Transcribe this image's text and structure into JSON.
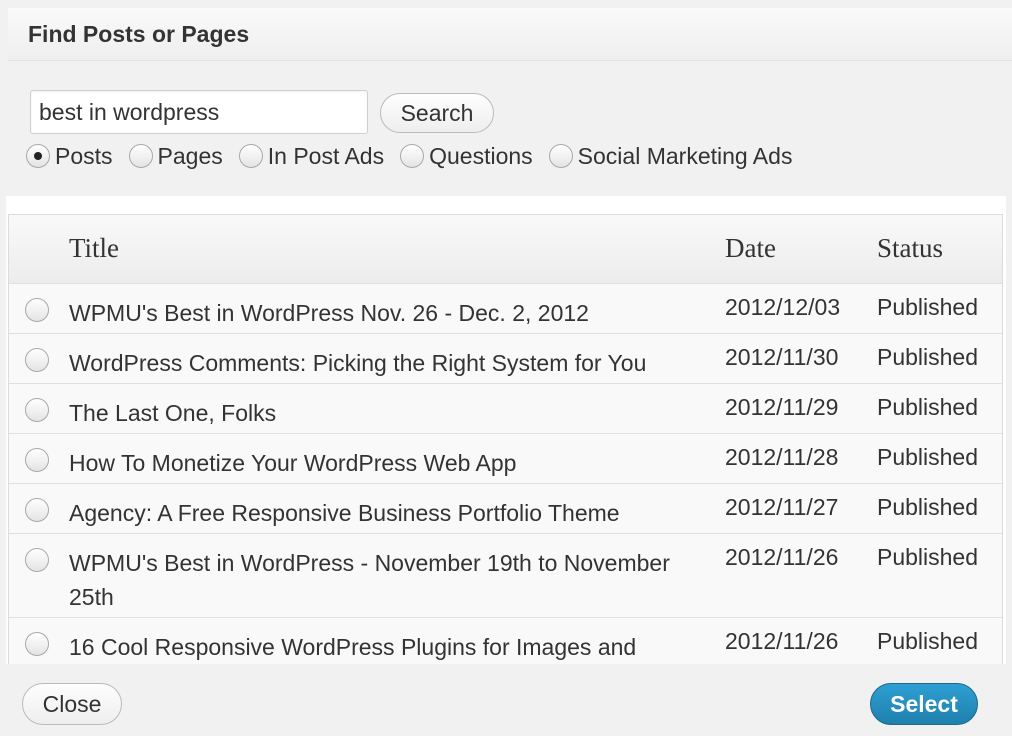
{
  "dialog": {
    "title": "Find Posts or Pages"
  },
  "search": {
    "value": "best in wordpress",
    "button_label": "Search"
  },
  "filters": [
    {
      "label": "Posts",
      "checked": true
    },
    {
      "label": "Pages",
      "checked": false
    },
    {
      "label": "In Post Ads",
      "checked": false
    },
    {
      "label": "Questions",
      "checked": false
    },
    {
      "label": "Social Marketing Ads",
      "checked": false
    }
  ],
  "table": {
    "columns": [
      "Title",
      "Date",
      "Status"
    ],
    "rows": [
      {
        "title": "WPMU's Best in WordPress Nov. 26 - Dec. 2, 2012",
        "date": "2012/12/03",
        "status": "Published"
      },
      {
        "title": "WordPress Comments: Picking the Right System for You",
        "date": "2012/11/30",
        "status": "Published"
      },
      {
        "title": "The Last One, Folks",
        "date": "2012/11/29",
        "status": "Published"
      },
      {
        "title": "How To Monetize Your WordPress Web App",
        "date": "2012/11/28",
        "status": "Published"
      },
      {
        "title": "Agency: A Free Responsive Business Portfolio Theme",
        "date": "2012/11/27",
        "status": "Published"
      },
      {
        "title": "WPMU's Best in WordPress - November 19th to November 25th",
        "date": "2012/11/26",
        "status": "Published"
      },
      {
        "title": "16 Cool Responsive WordPress Plugins for Images and",
        "date": "2012/11/26",
        "status": "Published"
      }
    ]
  },
  "footer": {
    "close_label": "Close",
    "select_label": "Select"
  },
  "colors": {
    "primary_button": "#2189b8",
    "dialog_background": "#f1f1f1"
  }
}
